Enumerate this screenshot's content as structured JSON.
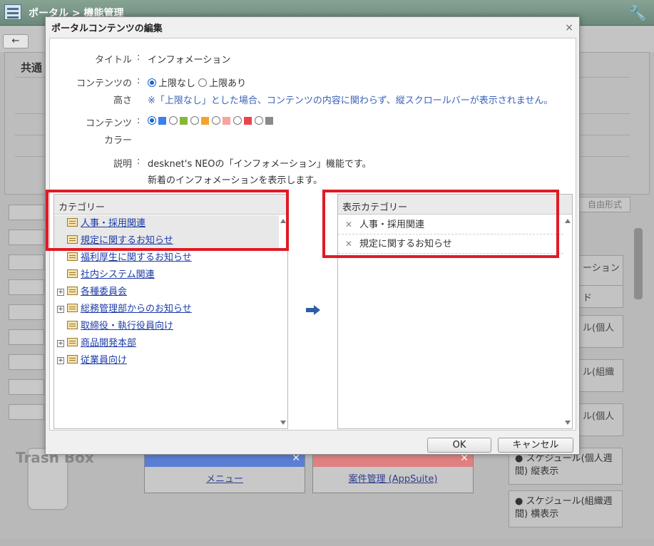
{
  "app": {
    "breadcrumb": "ポータル > 機能管理",
    "section_title": "共通",
    "right_tab": "自由形式",
    "right_items": [
      "ーション",
      "ド",
      "ル(個人",
      "ル(組織",
      "ル(個人"
    ],
    "big_items": [
      "スケジュール(個人週間) 縦表示",
      "スケジュール(組織週間) 横表示"
    ],
    "trash_label": "Trash Box",
    "widgets": [
      {
        "label": "メニュー",
        "color": "#5b7fd4"
      },
      {
        "label": "案件管理 (AppSuite)",
        "color": "#e08080"
      }
    ]
  },
  "dialog": {
    "title": "ポータルコンテンツの編集",
    "close_icon": "×",
    "fields": {
      "title_label": "タイトル",
      "title_value": "インフォメーション",
      "height_label_1": "コンテンツの",
      "height_label_2": "高さ",
      "height_opt_1": "上限なし",
      "height_opt_2": "上限あり",
      "height_note": "※「上限なし」とした場合、コンテンツの内容に関わらず、縦スクロールバーが表示されません。",
      "color_label_1": "コンテンツ",
      "color_label_2": "カラー",
      "colors": [
        "#3d7ef0",
        "#86b837",
        "#f3a32c",
        "#f7a3a0",
        "#e8454a",
        "#8a8a8a"
      ],
      "desc_label": "説明",
      "desc_line_1": "desknet's NEOの「インフォメーション」機能です。",
      "desc_line_2": "新着のインフォメーションを表示します。"
    },
    "category_header": "カテゴリー",
    "categories": [
      {
        "label": "人事・採用関連",
        "expandable": false,
        "selected": true
      },
      {
        "label": "規定に関するお知らせ",
        "expandable": false,
        "selected": true
      },
      {
        "label": "福利厚生に関するお知らせ",
        "expandable": false,
        "selected": false
      },
      {
        "label": "社内システム関連",
        "expandable": false,
        "selected": false
      },
      {
        "label": "各種委員会",
        "expandable": true,
        "selected": false
      },
      {
        "label": "総務管理部からのお知らせ",
        "expandable": true,
        "selected": false
      },
      {
        "label": "取締役・執行役員向け",
        "expandable": false,
        "selected": false
      },
      {
        "label": "商品開発本部",
        "expandable": true,
        "selected": false
      },
      {
        "label": "従業員向け",
        "expandable": true,
        "selected": false
      }
    ],
    "display_header": "表示カテゴリー",
    "display_categories": [
      "人事・採用関連",
      "規定に関するお知らせ"
    ],
    "ok_label": "OK",
    "cancel_label": "キャンセル",
    "highlight_color": "#e01b24"
  }
}
